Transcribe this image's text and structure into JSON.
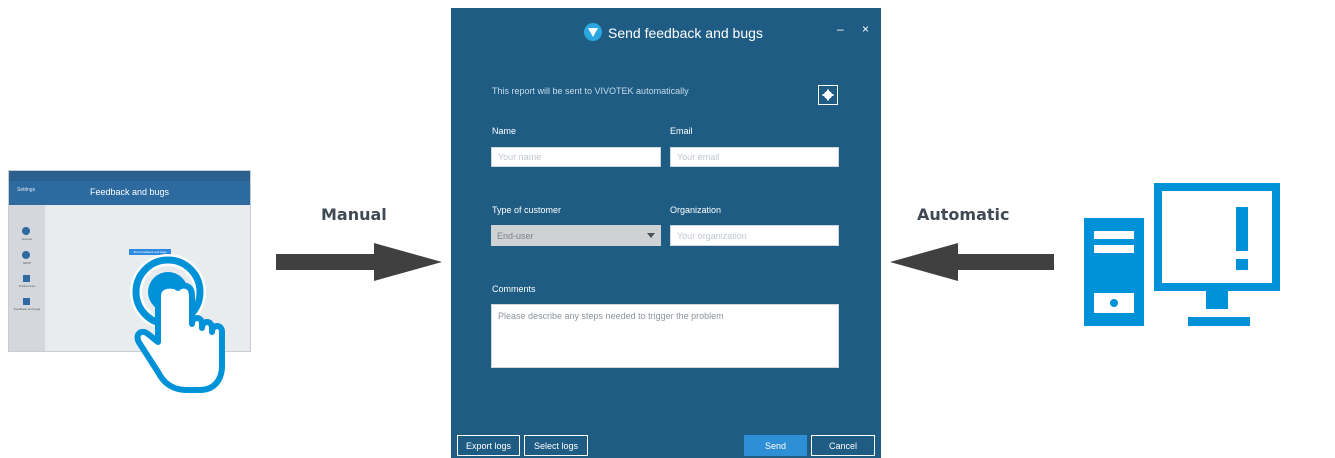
{
  "colors": {
    "dialog_bg": "#1e5c84",
    "accent_blue": "#0092d8",
    "arrow": "#404040",
    "send_button": "#2e8fd6"
  },
  "labels": {
    "manual": "Manual",
    "automatic": "Automatic"
  },
  "mini_screenshot": {
    "back_label": "Settings",
    "title": "Feedback and bugs",
    "button_label": "Send feedback and bugs",
    "side_items": [
      "License",
      "SMTP",
      "Preferences",
      "Feedback and bugs"
    ]
  },
  "dialog": {
    "title": "Send feedback and bugs",
    "minimize": "–",
    "close": "×",
    "note": "This report will be sent to VIVOTEK automatically",
    "gear_icon": "gear-icon",
    "fields": {
      "name_label": "Name",
      "name_placeholder": "Your name",
      "email_label": "Email",
      "email_placeholder": "Your email",
      "customer_type_label": "Type of customer",
      "customer_type_value": "End-user",
      "organization_label": "Organization",
      "organization_placeholder": "Your organization",
      "comments_label": "Comments",
      "comments_placeholder": "Please describe any steps needed to trigger the problem"
    },
    "buttons": {
      "export_logs": "Export logs",
      "select_logs": "Select logs",
      "send": "Send",
      "cancel": "Cancel"
    }
  },
  "icons": [
    "touch-hand-icon",
    "arrow-right-icon",
    "arrow-left-icon",
    "desktop-alert-icon"
  ]
}
